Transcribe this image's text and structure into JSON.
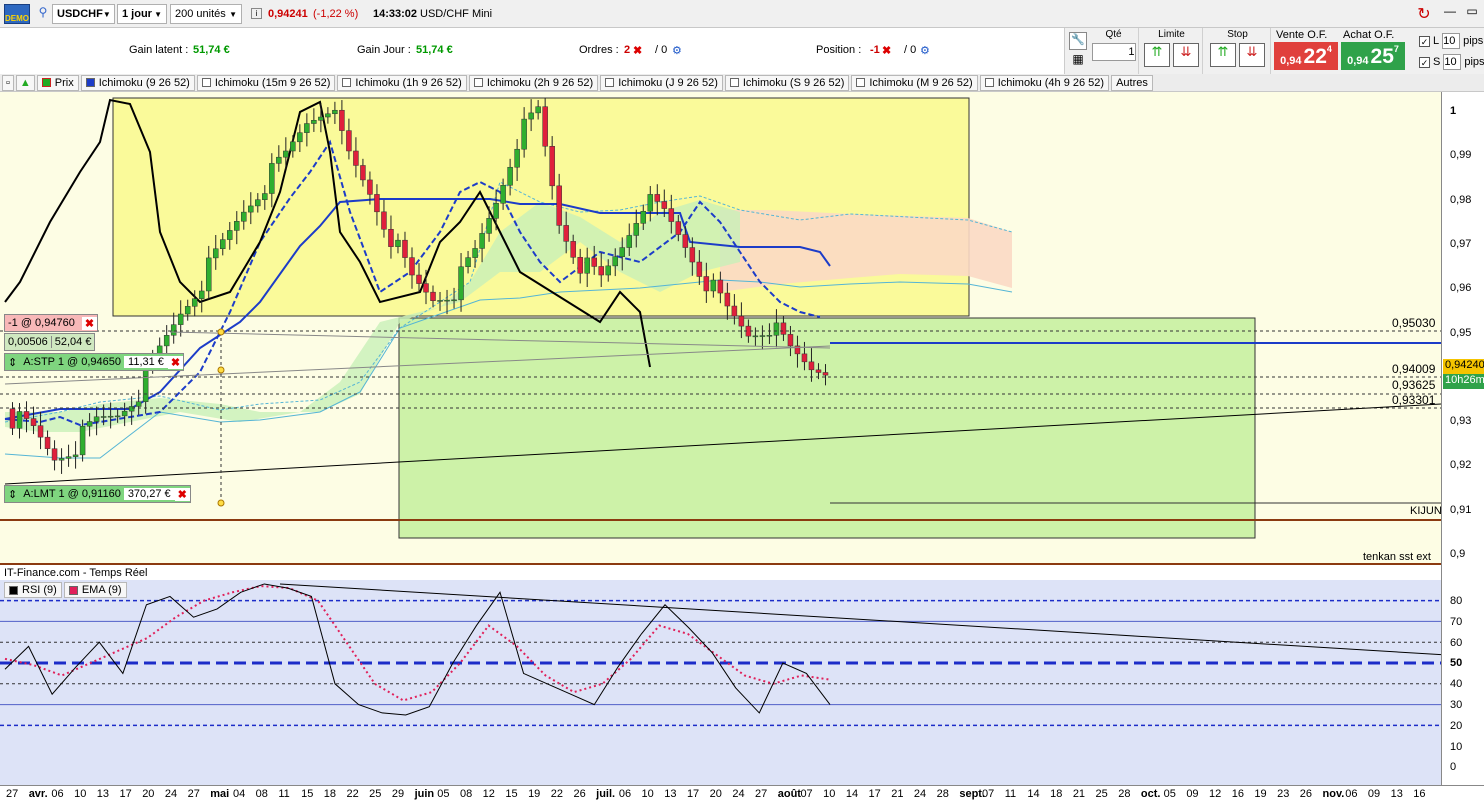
{
  "toolbar": {
    "demo_label": "DEMO",
    "symbol": "USDCHF",
    "period": "1 jour",
    "units": "200 unités",
    "quote_price": "0,94241",
    "quote_change": "(-1,22 %)",
    "quote_time": "14:33:02",
    "quote_name": "USD/CHF Mini"
  },
  "info": {
    "gain_latent_label": "Gain latent :",
    "gain_latent_value": "51,74 €",
    "gain_jour_label": "Gain Jour :",
    "gain_jour_value": "51,74 €",
    "ordres_label": "Ordres :",
    "ordres_count": "2",
    "ordres_zero": "/ 0",
    "position_label": "Position :",
    "position_value": "-1",
    "position_zero": "/ 0"
  },
  "order_panel": {
    "qte_label": "Qté",
    "qte_value": "1",
    "limite_label": "Limite",
    "stop_label": "Stop",
    "vente_label": "Vente O.F.",
    "vente_small": "0,94",
    "vente_big": "22",
    "vente_sup": "4",
    "achat_label": "Achat O.F.",
    "achat_small": "0,94",
    "achat_big": "25",
    "achat_sup": "7",
    "l_label": "L",
    "s_label": "S",
    "l_pips": "10",
    "s_pips": "10",
    "pips_label": "pips",
    "colors": {
      "vente": "#e0403c",
      "achat": "#2fa24a"
    }
  },
  "indicators": [
    {
      "label": "Prix",
      "checked": true
    },
    {
      "label": "Ichimoku (9 26 52)",
      "checked": true
    },
    {
      "label": "Ichimoku (15m 9 26 52)",
      "checked": false
    },
    {
      "label": "Ichimoku (1h 9 26 52)",
      "checked": false
    },
    {
      "label": "Ichimoku (2h 9 26 52)",
      "checked": false
    },
    {
      "label": "Ichimoku (J 9 26 52)",
      "checked": false
    },
    {
      "label": "Ichimoku (S 9 26 52)",
      "checked": false
    },
    {
      "label": "Ichimoku (M 9 26 52)",
      "checked": false
    },
    {
      "label": "Ichimoku (4h 9 26 52)",
      "checked": false
    },
    {
      "label": "Autres",
      "checked": null
    }
  ],
  "orders": {
    "position_tag": "-1 @ 0,94760",
    "position_diff": "0,00506",
    "position_gain": "52,04 €",
    "stop_tag": "A:STP  1 @ 0,94650",
    "stop_gain": "11,31 €",
    "limit_tag": "A:LMT  1 @ 0,91160",
    "limit_gain": "370,27 €"
  },
  "levels": {
    "l1": "0,95030",
    "l2": "0,94009",
    "l3": "0,93625",
    "l4": "0,93301",
    "kijun": "KIJUN",
    "tenkan": "tenkan  sst  ext",
    "current_price": "0,94240",
    "countdown": "10h26m"
  },
  "rsi": {
    "source": "IT-Finance.com - Temps Réel",
    "rsi_label": "RSI (9)",
    "ema_label": "EMA (9)",
    "ticks": [
      "80",
      "70",
      "60",
      "50",
      "40",
      "30",
      "20",
      "10",
      "0"
    ]
  },
  "chart_data": {
    "type": "candlestick",
    "y_ticks": [
      "1",
      "0,99",
      "0,98",
      "0,97",
      "0,96",
      "0,95",
      "0,94",
      "0,93",
      "0,92",
      "0,91",
      "0,9"
    ],
    "ylim": [
      0.9,
      1.0
    ],
    "x_ticks": [
      "27",
      "avr.",
      "06",
      "10",
      "13",
      "17",
      "20",
      "24",
      "27",
      "mai",
      "04",
      "08",
      "11",
      "15",
      "18",
      "22",
      "25",
      "29",
      "juin",
      "05",
      "08",
      "12",
      "15",
      "19",
      "22",
      "26",
      "juil.",
      "06",
      "10",
      "13",
      "17",
      "20",
      "24",
      "27",
      "août",
      "07",
      "10",
      "14",
      "17",
      "21",
      "24",
      "28",
      "sept.",
      "07",
      "11",
      "14",
      "18",
      "21",
      "25",
      "28",
      "oct.",
      "05",
      "09",
      "12",
      "16",
      "19",
      "23",
      "26",
      "nov.",
      "06",
      "09",
      "13",
      "16"
    ],
    "series": [
      {
        "name": "Prix",
        "close_points": [
          0.931,
          0.928,
          0.922,
          0.925,
          0.93,
          0.932,
          0.937,
          0.946,
          0.955,
          0.962,
          0.97,
          0.978,
          0.984,
          0.99,
          0.998,
          1.002,
          0.99,
          0.982,
          0.972,
          0.962,
          0.958,
          0.96,
          0.968,
          0.98,
          0.994,
          1.0,
          0.975,
          0.966,
          0.962,
          0.97,
          0.98,
          0.977,
          0.97,
          0.962,
          0.955,
          0.95,
          0.952,
          0.946,
          0.9424
        ]
      },
      {
        "name": "RSI (9)",
        "values": [
          47,
          58,
          35,
          48,
          60,
          45,
          78,
          82,
          72,
          76,
          84,
          88,
          86,
          82,
          40,
          30,
          26,
          25,
          29,
          50,
          68,
          84,
          45,
          40,
          35,
          30,
          48,
          64,
          78,
          67,
          55,
          38,
          26,
          50,
          45,
          30
        ]
      },
      {
        "name": "EMA (9)",
        "values": [
          52,
          49,
          44,
          50,
          56,
          62,
          72,
          80,
          84,
          87,
          86,
          80,
          60,
          40,
          32,
          36,
          50,
          68,
          58,
          44,
          36,
          40,
          52,
          68,
          64,
          54,
          44,
          40,
          44,
          42
        ]
      }
    ]
  }
}
